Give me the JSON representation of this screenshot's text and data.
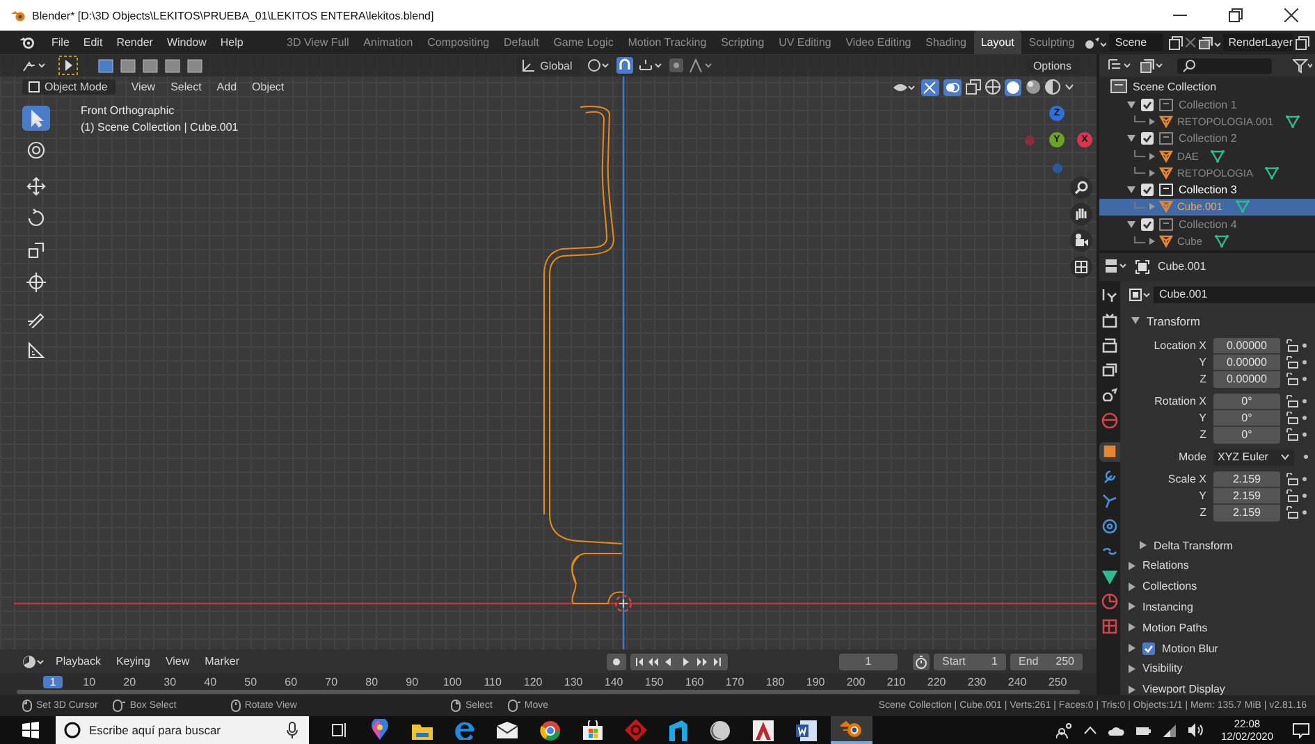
{
  "window": {
    "title": "Blender* [D:\\3D Objects\\LEKITOS\\PRUEBA_01\\LEKITOS ENTERA\\lekitos.blend]"
  },
  "menu": [
    "File",
    "Edit",
    "Render",
    "Window",
    "Help"
  ],
  "workspaces": [
    {
      "label": "3D View Full",
      "selected": false
    },
    {
      "label": "Animation",
      "selected": false
    },
    {
      "label": "Compositing",
      "selected": false
    },
    {
      "label": "Default",
      "selected": false
    },
    {
      "label": "Game Logic",
      "selected": false
    },
    {
      "label": "Motion Tracking",
      "selected": false
    },
    {
      "label": "Scripting",
      "selected": false
    },
    {
      "label": "UV Editing",
      "selected": false
    },
    {
      "label": "Video Editing",
      "selected": false
    },
    {
      "label": "Shading",
      "selected": false
    },
    {
      "label": "Layout",
      "selected": true
    },
    {
      "label": "Sculpting",
      "selected": false
    }
  ],
  "scene": "Scene",
  "render_layer": "RenderLayer",
  "viewport": {
    "orientation": "Global",
    "options": "Options",
    "mode": "Object Mode",
    "menus": [
      "View",
      "Select",
      "Add",
      "Object"
    ],
    "view_name": "Front Orthographic",
    "context": "(1) Scene Collection | Cube.001",
    "tools": [
      {
        "kind": "select",
        "selected": true
      },
      {
        "kind": "cursor",
        "selected": false
      },
      {
        "kind": "move",
        "selected": false
      },
      {
        "kind": "rotate",
        "selected": false
      },
      {
        "kind": "scale",
        "selected": false
      },
      {
        "kind": "transform",
        "selected": false
      },
      {
        "kind": "annotate",
        "selected": false
      },
      {
        "kind": "measure",
        "selected": false
      }
    ],
    "gizmo_axes": [
      {
        "label": "Z",
        "color": "#2f6fd6"
      },
      {
        "label": "Y",
        "color": "#6ba32a"
      },
      {
        "label": "X",
        "color": "#d6364f"
      }
    ]
  },
  "outliner": {
    "root": "Scene Collection",
    "collections": [
      {
        "label": "Collection 1",
        "checked": true,
        "active": false,
        "children": [
          {
            "label": "RETOPOLOGIA.001",
            "selected": false
          }
        ]
      },
      {
        "label": "Collection 2",
        "checked": true,
        "active": false,
        "children": [
          {
            "label": "DAE",
            "selected": false
          },
          {
            "label": "RETOPOLOGIA",
            "selected": false
          }
        ]
      },
      {
        "label": "Collection 3",
        "checked": true,
        "active": true,
        "children": [
          {
            "label": "Cube.001",
            "selected": true
          }
        ]
      },
      {
        "label": "Collection 4",
        "checked": true,
        "active": false,
        "children": [
          {
            "label": "Cube",
            "selected": false
          }
        ]
      }
    ]
  },
  "properties": {
    "object": "Cube.001",
    "name_field": "Cube.001",
    "tabs": [
      {
        "kind": "tool",
        "selected": false
      },
      {
        "kind": "render",
        "selected": false
      },
      {
        "kind": "output",
        "selected": false
      },
      {
        "kind": "view_layer",
        "selected": false
      },
      {
        "kind": "scene",
        "selected": false
      },
      {
        "kind": "world",
        "selected": false
      },
      {
        "kind": "object",
        "selected": true
      },
      {
        "kind": "modifiers",
        "selected": false
      },
      {
        "kind": "particles",
        "selected": false
      },
      {
        "kind": "physics",
        "selected": false
      },
      {
        "kind": "constraints",
        "selected": false
      },
      {
        "kind": "data",
        "selected": false
      },
      {
        "kind": "material",
        "selected": false
      },
      {
        "kind": "texture",
        "selected": false
      }
    ],
    "transform": {
      "label": "Transform",
      "expanded": true,
      "groups": [
        {
          "kind": "fields",
          "rows": [
            {
              "label": "Location X",
              "value": "0.00000"
            },
            {
              "label": "Y",
              "value": "0.00000"
            },
            {
              "label": "Z",
              "value": "0.00000"
            }
          ]
        },
        {
          "kind": "fields",
          "rows": [
            {
              "label": "Rotation X",
              "value": "0°"
            },
            {
              "label": "Y",
              "value": "0°"
            },
            {
              "label": "Z",
              "value": "0°"
            }
          ]
        },
        {
          "kind": "dropdown",
          "rows": [
            {
              "label": "Mode",
              "value": "XYZ Euler"
            }
          ]
        },
        {
          "kind": "fields",
          "rows": [
            {
              "label": "Scale X",
              "value": "2.159"
            },
            {
              "label": "Y",
              "value": "2.159"
            },
            {
              "label": "Z",
              "value": "2.159"
            }
          ]
        }
      ]
    },
    "panels": [
      {
        "label": "Delta Transform",
        "kind": "subpanel",
        "expanded": false
      },
      {
        "label": "Relations",
        "kind": "panel",
        "expanded": false
      },
      {
        "label": "Collections",
        "kind": "panel",
        "expanded": false
      },
      {
        "label": "Instancing",
        "kind": "panel",
        "expanded": false
      },
      {
        "label": "Motion Paths",
        "kind": "panel",
        "expanded": false
      },
      {
        "label": "Motion Blur",
        "kind": "checkbox",
        "expanded": false,
        "checked": true
      },
      {
        "label": "Visibility",
        "kind": "panel",
        "expanded": false
      },
      {
        "label": "Viewport Display",
        "kind": "panel",
        "expanded": false
      }
    ]
  },
  "timeline": {
    "menus": [
      "Playback",
      "Keying",
      "View",
      "Marker"
    ],
    "current_frame": "1",
    "start_label": "Start",
    "start": "1",
    "end_label": "End",
    "end": "250",
    "ticks": [
      {
        "label": "1",
        "selected": true
      },
      {
        "label": "10",
        "selected": false
      },
      {
        "label": "20",
        "selected": false
      },
      {
        "label": "30",
        "selected": false
      },
      {
        "label": "40",
        "selected": false
      },
      {
        "label": "50",
        "selected": false
      },
      {
        "label": "60",
        "selected": false
      },
      {
        "label": "70",
        "selected": false
      },
      {
        "label": "80",
        "selected": false
      },
      {
        "label": "90",
        "selected": false
      },
      {
        "label": "100",
        "selected": false
      },
      {
        "label": "110",
        "selected": false
      },
      {
        "label": "120",
        "selected": false
      },
      {
        "label": "130",
        "selected": false
      },
      {
        "label": "140",
        "selected": false
      },
      {
        "label": "150",
        "selected": false
      },
      {
        "label": "160",
        "selected": false
      },
      {
        "label": "170",
        "selected": false
      },
      {
        "label": "180",
        "selected": false
      },
      {
        "label": "190",
        "selected": false
      },
      {
        "label": "200",
        "selected": false
      },
      {
        "label": "210",
        "selected": false
      },
      {
        "label": "220",
        "selected": false
      },
      {
        "label": "230",
        "selected": false
      },
      {
        "label": "240",
        "selected": false
      },
      {
        "label": "250",
        "selected": false
      }
    ]
  },
  "status_bar": {
    "hints": [
      "Set 3D Cursor",
      "Box Select",
      "Rotate View",
      "Select",
      "Move"
    ],
    "info": "Scene Collection | Cube.001 | Verts:261 | Faces:0 | Tris:0 | Objects:1/1 | Mem: 135.7 MiB | v2.81.16"
  },
  "taskbar": {
    "search_placeholder": "Escribe aquí para buscar",
    "time": "22:08",
    "date": "12/02/2020"
  }
}
